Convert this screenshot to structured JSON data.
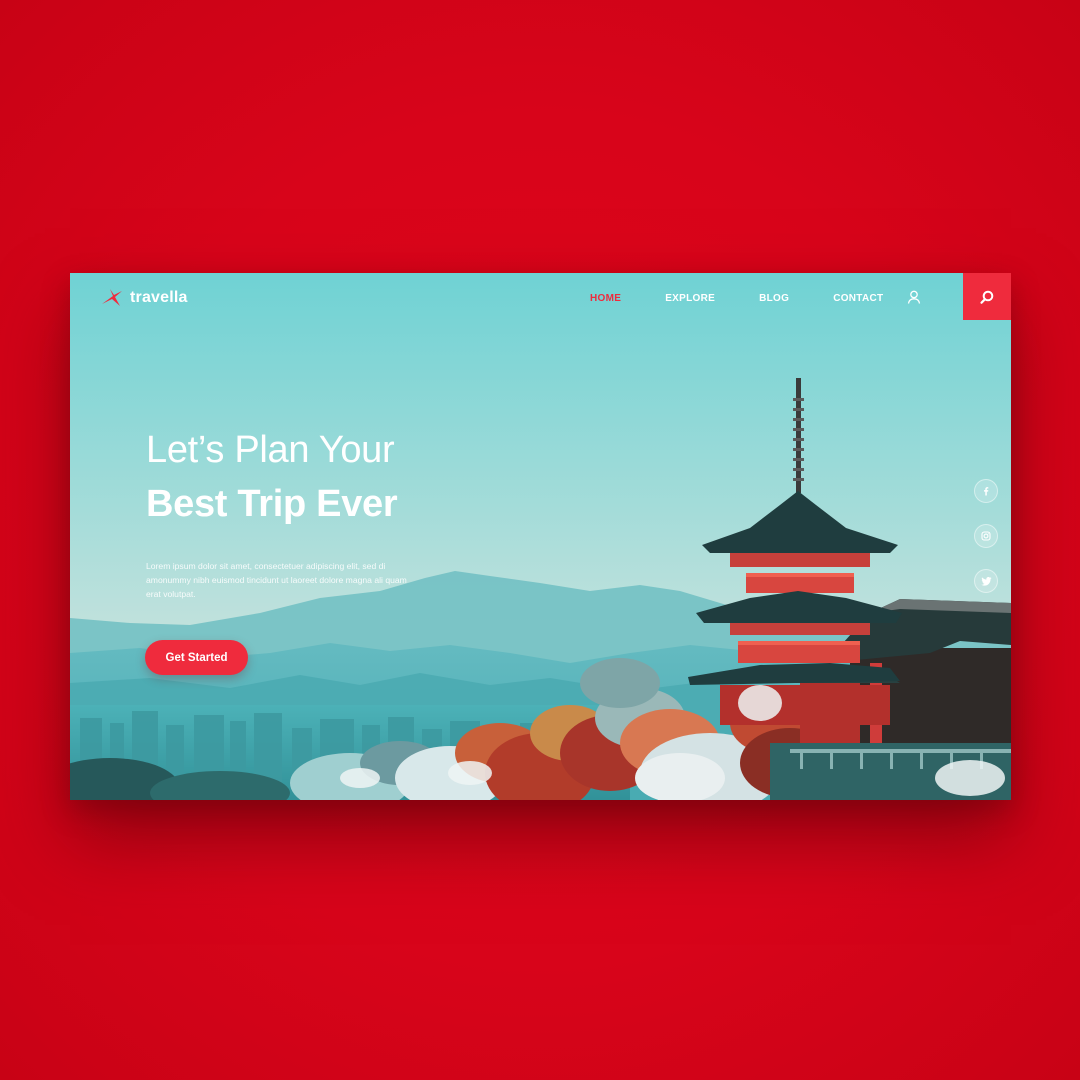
{
  "brand": {
    "name": "travella",
    "accent": "#ef2b3d",
    "page_background": "#e0061a",
    "sky_top": "#6fd2d4",
    "sky_bottom": "#b8dcd8"
  },
  "nav": {
    "items": [
      {
        "label": "HOME",
        "active": true
      },
      {
        "label": "EXPLORE",
        "active": false
      },
      {
        "label": "BLOG",
        "active": false
      },
      {
        "label": "CONTACT",
        "active": false
      }
    ],
    "user_icon": "user-icon",
    "search_icon": "search-icon"
  },
  "hero": {
    "line1": "Let’s Plan Your",
    "line2": "Best Trip Ever",
    "description": "Lorem ipsum dolor sit amet, consectetuer adipiscing elit, sed di amonummy nibh euismod tincidunt ut laoreet dolore magna ali quam erat volutpat.",
    "cta_label": "Get Started"
  },
  "social": [
    {
      "icon": "facebook-icon",
      "glyph": "f"
    },
    {
      "icon": "instagram-icon",
      "glyph": ""
    },
    {
      "icon": "twitter-icon",
      "glyph": ""
    }
  ]
}
